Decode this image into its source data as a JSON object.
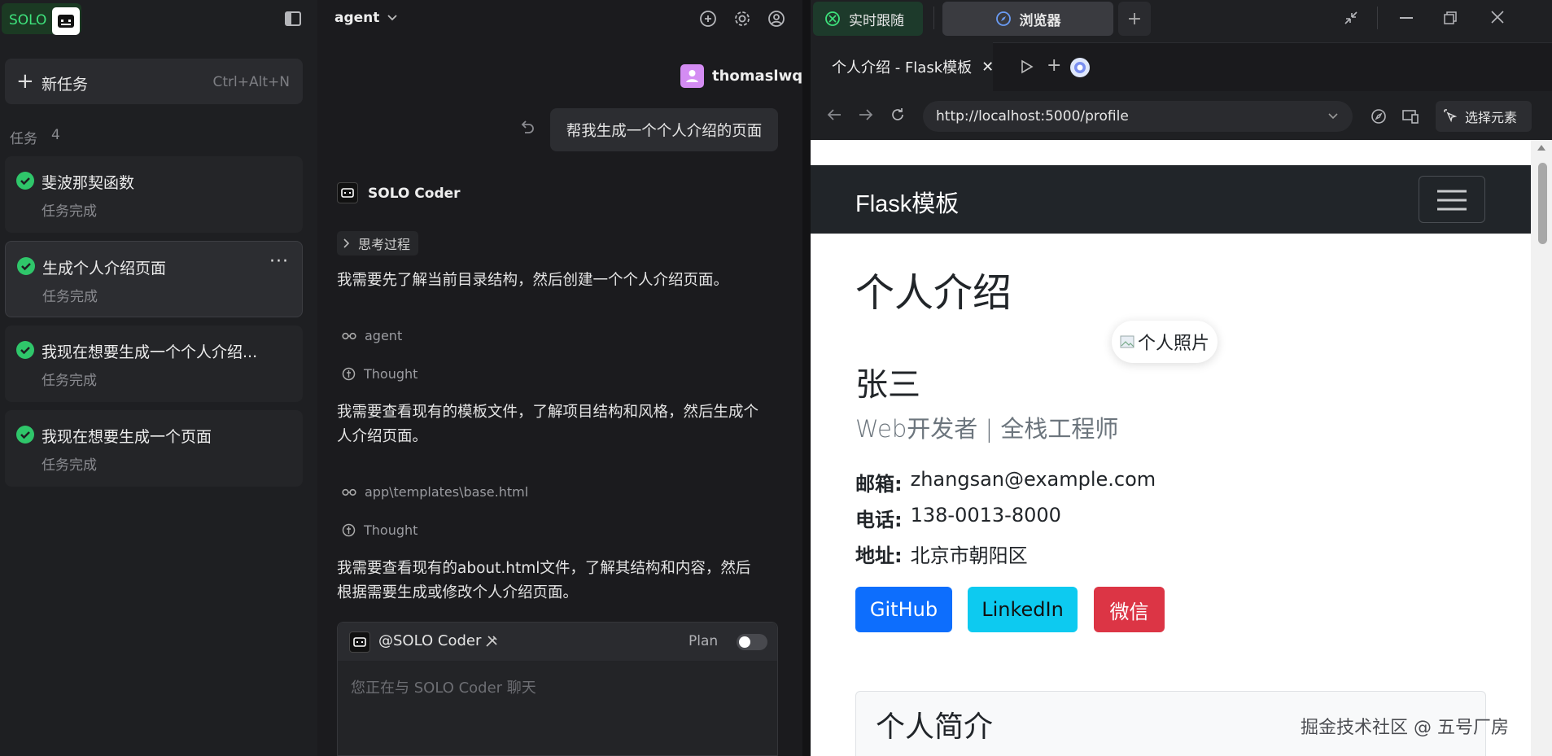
{
  "sidebar": {
    "logo_text": "SOLO",
    "new_task_label": "新任务",
    "new_task_shortcut": "Ctrl+Alt+N",
    "section_label": "任务",
    "task_count": "4",
    "tasks": [
      {
        "title": "斐波那契函数",
        "status": "任务完成"
      },
      {
        "title": "生成个人介绍页面",
        "status": "任务完成"
      },
      {
        "title": "我现在想要生成一个个人介绍...",
        "status": "任务完成"
      },
      {
        "title": "我现在想要生成一个页面",
        "status": "任务完成"
      }
    ]
  },
  "chat": {
    "agent_selector": "agent",
    "user_name": "thomaslwq",
    "user_message": "帮我生成一个个人介绍的页面",
    "assistant_name": "SOLO Coder",
    "thinking_label": "思考过程",
    "para1": "我需要先了解当前目录结构，然后创建一个个人介绍页面。",
    "tool1_label": "agent",
    "thought1": "Thought",
    "para2_line1": "我需要查看现有的模板文件，了解项目结构和风格，然后生成个",
    "para2_line2": "人介绍页面。",
    "tool2_label": "app\\templates\\base.html",
    "thought2": "Thought",
    "para3_line1": "我需要查看现有的about.html文件，了解其结构和内容，然后",
    "para3_line2": "根据需要生成或修改个人介绍页面。",
    "input_agent_tag": "@SOLO Coder",
    "plan_label": "Plan",
    "input_placeholder": "您正在与 SOLO Coder 聊天"
  },
  "browser": {
    "tab_live": "实时跟随",
    "tab_browser": "浏览器",
    "page_tab_title": "个人介绍 - Flask模板",
    "url": "http://localhost:5000/profile",
    "select_element_label": "选择元素",
    "page": {
      "navbar_brand": "Flask模板",
      "heading": "个人介绍",
      "photo_alt": "个人照片",
      "name": "张三",
      "role": "Web开发者 | 全栈工程师",
      "email_label": "邮箱:",
      "email": "zhangsan@example.com",
      "phone_label": "电话:",
      "phone": "138-0013-8000",
      "address_label": "地址:",
      "address": "北京市朝阳区",
      "buttons": [
        "GitHub",
        "LinkedIn",
        "微信"
      ],
      "section_title": "个人简介"
    },
    "watermark": "掘金技术社区 @ 五号厂房"
  },
  "colors": {
    "github": "#0d6efd",
    "linkedin": "#0dcaf0",
    "wechat": "#dc3545",
    "accent_green": "#2fc66a"
  }
}
